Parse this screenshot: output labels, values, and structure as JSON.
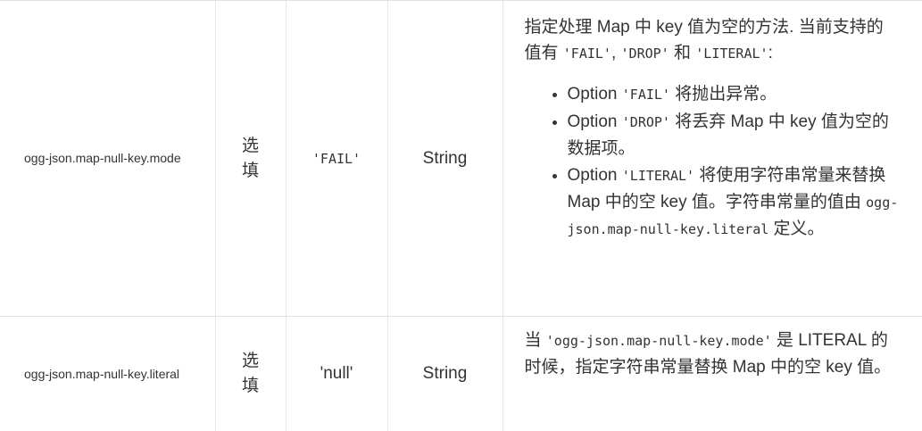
{
  "rows": [
    {
      "key": "ogg-json.map-null-key.mode",
      "required": "选填",
      "default": "'FAIL'",
      "type": "String",
      "desc_intro_1": "指定处理 Map 中 key 值为空的方法. 当前支持的值有 ",
      "desc_intro_fail": "'FAIL'",
      "desc_intro_sep1": ", ",
      "desc_intro_drop": "'DROP'",
      "desc_intro_and": " 和 ",
      "desc_intro_literal": "'LITERAL'",
      "desc_intro_end": ":",
      "options": [
        {
          "prefix": "Option ",
          "code": "'FAIL'",
          "text": " 将抛出异常。"
        },
        {
          "prefix": "Option ",
          "code": "'DROP'",
          "text": " 将丢弃 Map 中 key 值为空的数据项。"
        },
        {
          "prefix": "Option ",
          "code": "'LITERAL'",
          "text": " 将使用字符串常量来替换 Map 中的空 key 值。字符串常量的值由 ",
          "code2": "ogg-json.map-null-key.literal",
          "text2": " 定义。"
        }
      ]
    },
    {
      "key": "ogg-json.map-null-key.literal",
      "required": "选填",
      "default": "'null'",
      "type": "String",
      "desc_prefix": "当 ",
      "desc_code": "'ogg-json.map-null-key.mode'",
      "desc_text": " 是 LITERAL 的时候，指定字符串常量替换 Map 中的空 key 值。"
    }
  ]
}
